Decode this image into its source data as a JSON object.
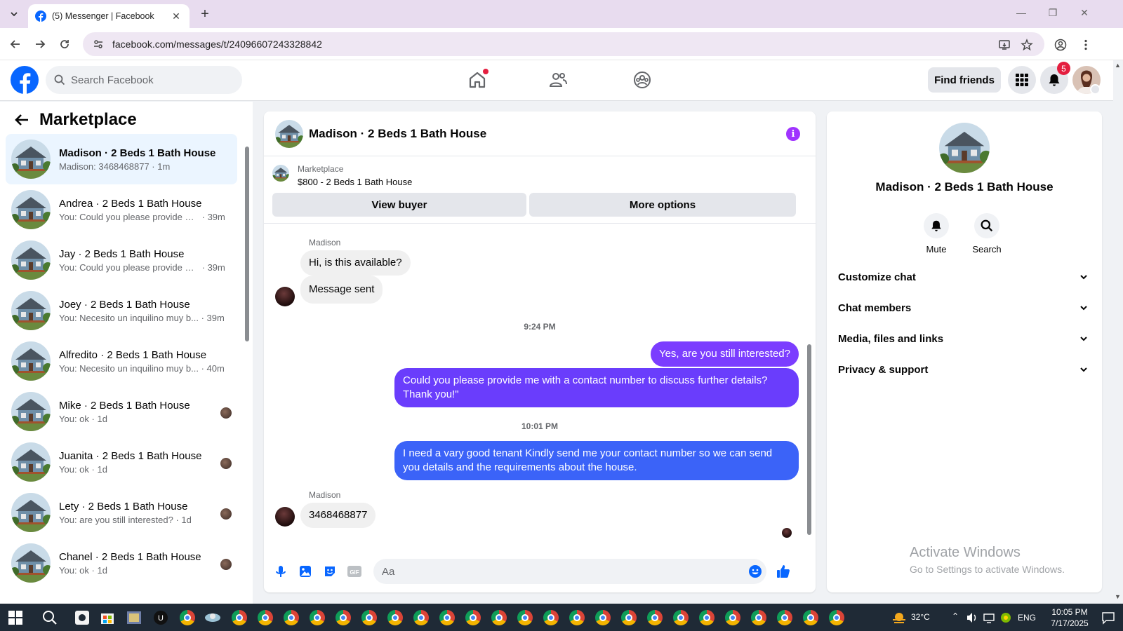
{
  "browser": {
    "tab_title": "(5) Messenger | Facebook",
    "url": "facebook.com/messages/t/24096607243328842"
  },
  "fb": {
    "search_placeholder": "Search Facebook",
    "find_friends": "Find friends",
    "notification_count": "5"
  },
  "left_panel": {
    "title": "Marketplace",
    "conversations": [
      {
        "name": "Madison · 2 Beds 1 Bath House",
        "snippet": "Madison: 3468468877",
        "time": "1m",
        "active": true
      },
      {
        "name": "Andrea · 2 Beds 1 Bath House",
        "snippet": "You: Could you please provide m...",
        "time": "39m"
      },
      {
        "name": "Jay · 2 Beds 1 Bath House",
        "snippet": "You: Could you please provide m...",
        "time": "39m"
      },
      {
        "name": "Joey · 2 Beds 1 Bath House",
        "snippet": "You: Necesito un inquilino muy b...",
        "time": "39m"
      },
      {
        "name": "Alfredito · 2 Beds 1 Bath House",
        "snippet": "You: Necesito un inquilino muy b...",
        "time": "40m"
      },
      {
        "name": "Mike · 2 Beds 1 Bath House",
        "snippet": "You: ok",
        "time": "1d"
      },
      {
        "name": "Juanita · 2 Beds 1 Bath House",
        "snippet": "You: ok",
        "time": "1d"
      },
      {
        "name": "Lety · 2 Beds 1 Bath House",
        "snippet": "You: are you still interested?",
        "time": "1d"
      },
      {
        "name": "Chanel · 2 Beds 1 Bath House",
        "snippet": "You: ok",
        "time": "1d"
      }
    ]
  },
  "chat": {
    "title": "Madison · 2 Beds 1 Bath House",
    "marketplace_label": "Marketplace",
    "listing": "$800 - 2 Beds 1 Bath House",
    "view_buyer": "View buyer",
    "more_options": "More options",
    "sender_name": "Madison",
    "sender_name_2": "Madison",
    "msg_1": "Hi, is this available?",
    "msg_2": "Message sent",
    "time_1": "9:24 PM",
    "msg_3": "Yes, are you still interested?",
    "msg_4": "Could you please provide me with a contact number to discuss further details? Thank you!\"",
    "time_2": "10:01 PM",
    "msg_5": "I need a vary good tenant Kindly send me your contact number so we can send you details and the requirements about the house.",
    "msg_6": "3468468877",
    "composer_placeholder": "Aa"
  },
  "info_panel": {
    "name": "Madison · 2 Beds 1 Bath House",
    "mute": "Mute",
    "search": "Search",
    "sections": [
      "Customize chat",
      "Chat members",
      "Media, files and links",
      "Privacy & support"
    ]
  },
  "watermark": {
    "line1": "Activate Windows",
    "line2": "Go to Settings to activate Windows."
  },
  "taskbar": {
    "weather": "32°C",
    "lang": "ENG",
    "time": "10:05 PM",
    "date": "7/17/2025"
  },
  "colors": {
    "fb_blue": "#0866ff",
    "bubble_purple": "#7b3dff",
    "bubble_blue": "#3b63f8",
    "info_purple": "#a033ff"
  }
}
